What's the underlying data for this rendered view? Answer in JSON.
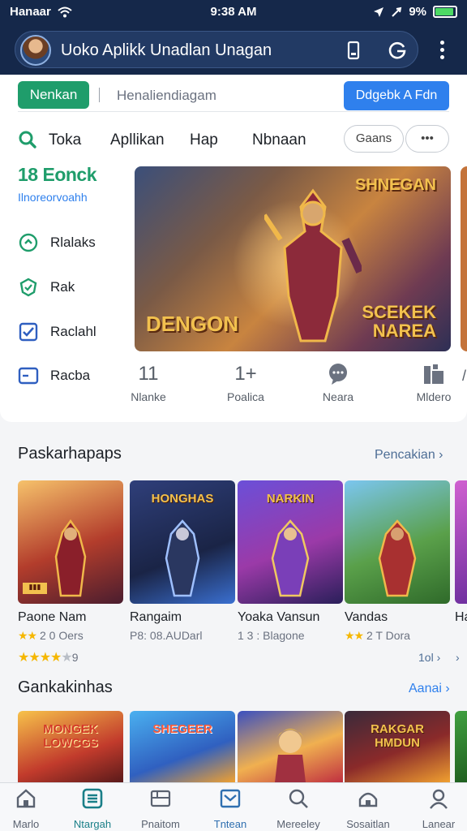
{
  "status_bar": {
    "carrier": "Hanaar",
    "time": "9:38 AM",
    "battery_text": "9%",
    "battery_level": 0.9
  },
  "header": {
    "title": "Uoko Aplikk Unadlan Unagan"
  },
  "search_row": {
    "primary_button": "Nenkan",
    "search_text": "Henaliendiagam",
    "action_button": "Ddgebk A  Fdn"
  },
  "nav": {
    "items": [
      "Toka",
      "Apllikan",
      "Hap",
      "Nbnaan"
    ],
    "chip_label": "Gaans",
    "more_chip": "•••"
  },
  "sidebar": {
    "title": "18 Eonck",
    "subtitle": "Ilnoreorvoahh",
    "items": [
      {
        "label": "Rlalaks",
        "icon": "refresh-circle-icon"
      },
      {
        "label": "Rak",
        "icon": "shield-icon"
      },
      {
        "label": "Raclahl",
        "icon": "checkbox-icon"
      },
      {
        "label": "Racba",
        "icon": "window-icon"
      }
    ]
  },
  "banner": {
    "left_text": "DENGON",
    "top_right_text": "SHNEGAN",
    "bottom_right_text": "SCEKEK NAREA"
  },
  "stats": [
    {
      "value": "11",
      "label": "Nlanke"
    },
    {
      "value": "1+",
      "label": "Poalica"
    },
    {
      "value": "",
      "label": "Neara",
      "icon": "chat-bubble-icon"
    },
    {
      "value": "",
      "label": "Mldero",
      "icon": "folder-icon"
    }
  ],
  "section1": {
    "title": "Paskarhapaps",
    "link": "Pencakian",
    "apps": [
      {
        "name": "Paone Nam",
        "meta": "2 0 Oers",
        "art_text": "",
        "rating": 2
      },
      {
        "name": "Rangaim",
        "meta": "P8: 08.AUDarl",
        "art_text": "HONGHAS",
        "rating": 0
      },
      {
        "name": "Yoaka Vansun",
        "meta": "1 3 : Blagone",
        "art_text": "NARKIN",
        "rating": 0
      },
      {
        "name": "Vandas",
        "meta": "2 T Dora",
        "art_text": "",
        "rating": 2
      },
      {
        "name": "Ha",
        "meta": "",
        "art_text": "",
        "rating": 0
      }
    ],
    "footer_stars": 4,
    "footer_text": "9",
    "footer_link": "1ol"
  },
  "section2": {
    "title": "Gankakinhas",
    "link": "Aanai",
    "apps": [
      {
        "art_text": "MONGEK LOWCGS"
      },
      {
        "art_text": "SHEGEER"
      },
      {
        "art_text": ""
      },
      {
        "art_text": "RAKGAR HMDUN"
      }
    ]
  },
  "bottom_nav": [
    {
      "label": "Marlo",
      "icon": "home-icon"
    },
    {
      "label": "Ntargah",
      "icon": "apps-icon",
      "active": true
    },
    {
      "label": "Pnaitom",
      "icon": "list-icon"
    },
    {
      "label": "Tntean",
      "icon": "inbox-icon"
    },
    {
      "label": "Mereeley",
      "icon": "search-icon"
    },
    {
      "label": "Sosaitlan",
      "icon": "cloud-icon"
    },
    {
      "label": "Lanear",
      "icon": "person-icon"
    }
  ],
  "colors": {
    "header_bg": "#15284a",
    "accent_green": "#1f9d6b",
    "accent_blue": "#2f80ed",
    "star": "#f5b700"
  }
}
